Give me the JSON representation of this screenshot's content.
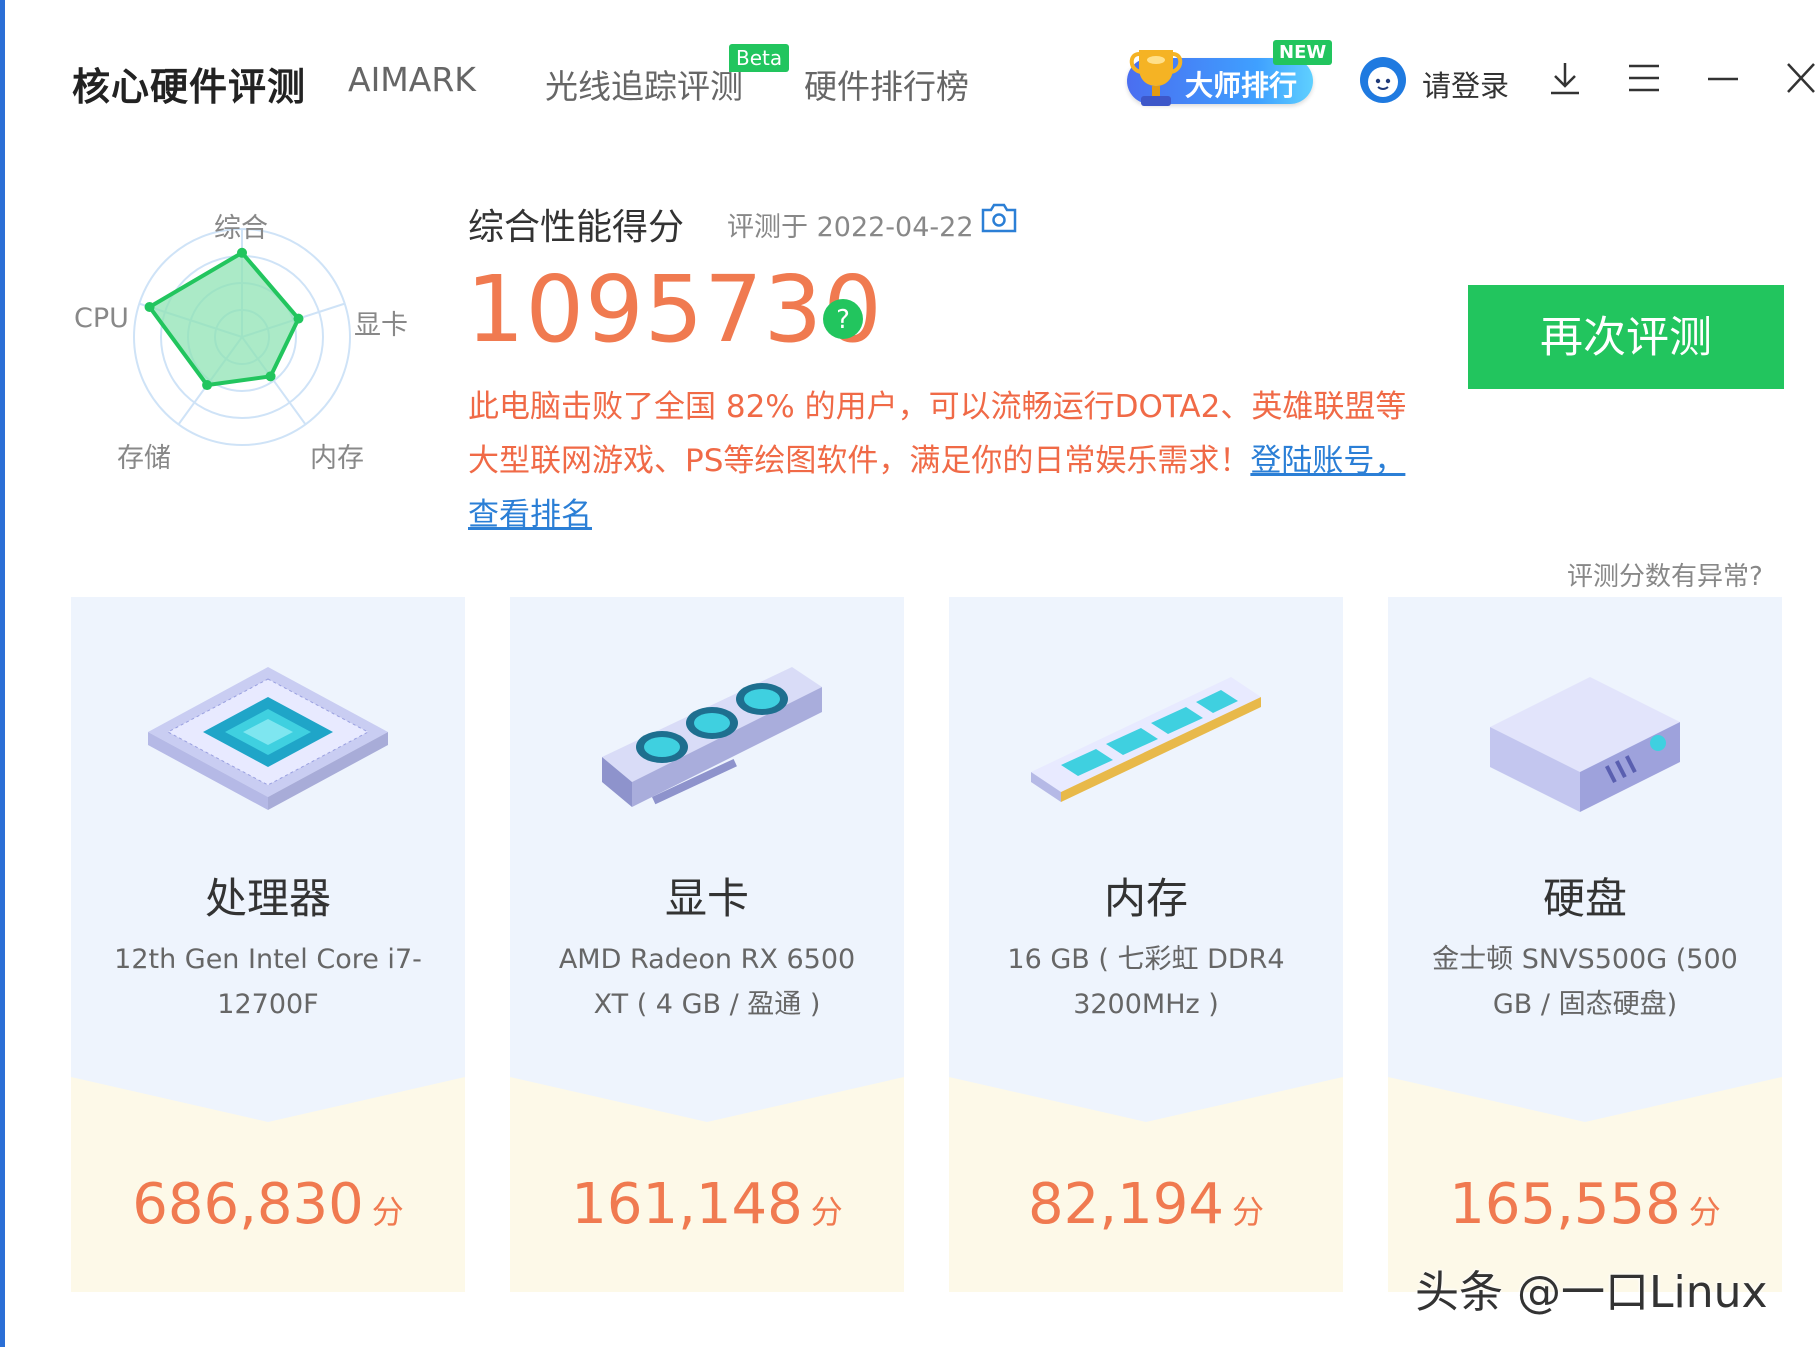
{
  "header": {
    "title": "核心硬件评测",
    "tabs": [
      {
        "label": "AIMARK"
      },
      {
        "label": "光线追踪评测",
        "badge": "Beta"
      },
      {
        "label": "硬件排行榜"
      }
    ],
    "master_rank": {
      "label": "大师排行",
      "badge": "NEW"
    },
    "login_label": "请登录",
    "icons": [
      "download-icon",
      "menu-icon",
      "minimize-icon",
      "close-icon"
    ]
  },
  "radar": {
    "labels": {
      "overall": "综合",
      "gpu": "显卡",
      "memory": "内存",
      "storage": "存储",
      "cpu": "CPU"
    },
    "relative_levels": [
      0.78,
      0.55,
      0.45,
      0.55,
      0.9
    ]
  },
  "score": {
    "title": "综合性能得分",
    "date": "评测于 2022-04-22",
    "total": "1095730",
    "help": "?",
    "description": "此电脑击败了全国 82% 的用户，可以流畅运行DOTA2、英雄联盟等大型联网游戏、PS等绘图软件，满足你的日常娱乐需求！",
    "link": "登陆账号，查看排名",
    "retest_label": "再次评测",
    "anomaly_label": "评测分数有异常?"
  },
  "cards": [
    {
      "title": "处理器",
      "desc": "12th Gen Intel Core i7-12700F",
      "score": "686,830",
      "unit": "分"
    },
    {
      "title": "显卡",
      "desc": "AMD Radeon RX 6500 XT ( 4 GB / 盈通 )",
      "score": "161,148",
      "unit": "分"
    },
    {
      "title": "内存",
      "desc": "16 GB ( 七彩虹 DDR4 3200MHz )",
      "score": "82,194",
      "unit": "分"
    },
    {
      "title": "硬盘",
      "desc": "金士顿 SNVS500G (500 GB / 固态硬盘)",
      "score": "165,558",
      "unit": "分"
    }
  ],
  "watermark": "头条 @一口Linux",
  "colors": {
    "accent_green": "#22c55e",
    "score_orange": "#f07a50",
    "link_blue": "#2b7fd6",
    "card_bg": "#eef4fd",
    "card_bottom": "#fdf9e8"
  }
}
